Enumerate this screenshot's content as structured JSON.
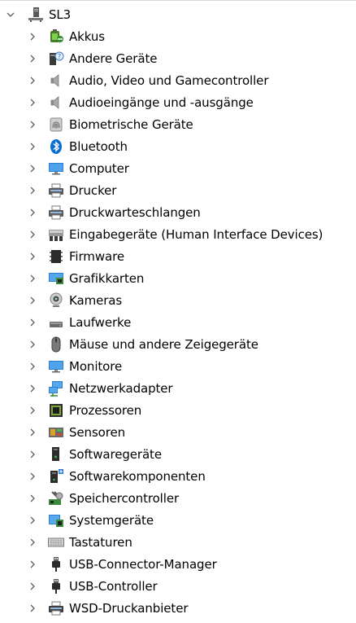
{
  "tree": {
    "root": {
      "label": "SL3",
      "icon": "computer-tower-icon",
      "expanded": true
    },
    "items": [
      {
        "label": "Akkus",
        "icon": "battery-icon"
      },
      {
        "label": "Andere Geräte",
        "icon": "unknown-device-icon"
      },
      {
        "label": "Audio, Video und Gamecontroller",
        "icon": "speaker-icon"
      },
      {
        "label": "Audioeingänge und -ausgänge",
        "icon": "speaker-icon"
      },
      {
        "label": "Biometrische Geräte",
        "icon": "fingerprint-icon"
      },
      {
        "label": "Bluetooth",
        "icon": "bluetooth-icon"
      },
      {
        "label": "Computer",
        "icon": "monitor-icon"
      },
      {
        "label": "Drucker",
        "icon": "printer-icon"
      },
      {
        "label": "Druckwarteschlangen",
        "icon": "printer-icon"
      },
      {
        "label": "Eingabegeräte (Human Interface Devices)",
        "icon": "hid-device-icon"
      },
      {
        "label": "Firmware",
        "icon": "firmware-chip-icon"
      },
      {
        "label": "Grafikkarten",
        "icon": "graphics-card-icon"
      },
      {
        "label": "Kameras",
        "icon": "webcam-icon"
      },
      {
        "label": "Laufwerke",
        "icon": "disk-drive-icon"
      },
      {
        "label": "Mäuse und andere Zeigegeräte",
        "icon": "mouse-icon"
      },
      {
        "label": "Monitore",
        "icon": "monitor-icon"
      },
      {
        "label": "Netzwerkadapter",
        "icon": "network-adapter-icon"
      },
      {
        "label": "Prozessoren",
        "icon": "processor-icon"
      },
      {
        "label": "Sensoren",
        "icon": "sensor-icon"
      },
      {
        "label": "Softwaregeräte",
        "icon": "software-device-icon"
      },
      {
        "label": "Softwarekomponenten",
        "icon": "software-component-icon"
      },
      {
        "label": "Speichercontroller",
        "icon": "storage-controller-icon"
      },
      {
        "label": "Systemgeräte",
        "icon": "system-device-icon"
      },
      {
        "label": "Tastaturen",
        "icon": "keyboard-icon"
      },
      {
        "label": "USB-Connector-Manager",
        "icon": "usb-plug-icon"
      },
      {
        "label": "USB-Controller",
        "icon": "usb-plug-icon"
      },
      {
        "label": "WSD-Druckanbieter",
        "icon": "wsd-printer-icon"
      }
    ]
  },
  "colors": {
    "chevron": "#606060",
    "text": "#000000",
    "accent": "#0078d7"
  }
}
